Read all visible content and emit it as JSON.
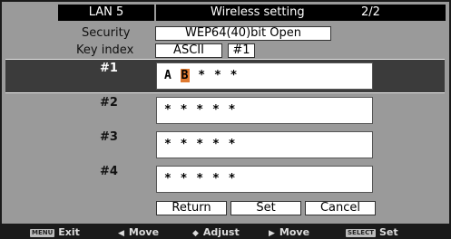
{
  "header": {
    "lan": "LAN 5",
    "title": "Wireless setting",
    "page": "2/2"
  },
  "security": {
    "label": "Security",
    "value": "WEP64(40)bit Open"
  },
  "key_index": {
    "label": "Key index",
    "format": "ASCII",
    "index": "#1"
  },
  "keys": [
    {
      "label": "#1",
      "value_prefix": "A ",
      "value_highlight": "B",
      "value_suffix": " * * *",
      "selected": true
    },
    {
      "label": "#2",
      "value": "* * * * *"
    },
    {
      "label": "#3",
      "value": "* * * * *"
    },
    {
      "label": "#4",
      "value": "* * * * *"
    }
  ],
  "buttons": {
    "return": "Return",
    "set": "Set",
    "cancel": "Cancel"
  },
  "footer": {
    "menu_key": "MENU",
    "exit": "Exit",
    "move_left": "Move",
    "adjust": "Adjust",
    "move_right": "Move",
    "select_key": "SELECT",
    "set": "Set"
  },
  "colors": {
    "highlight": "#e07a30",
    "selected_row": "#3b3b3b",
    "panel": "#9a9a9a"
  }
}
